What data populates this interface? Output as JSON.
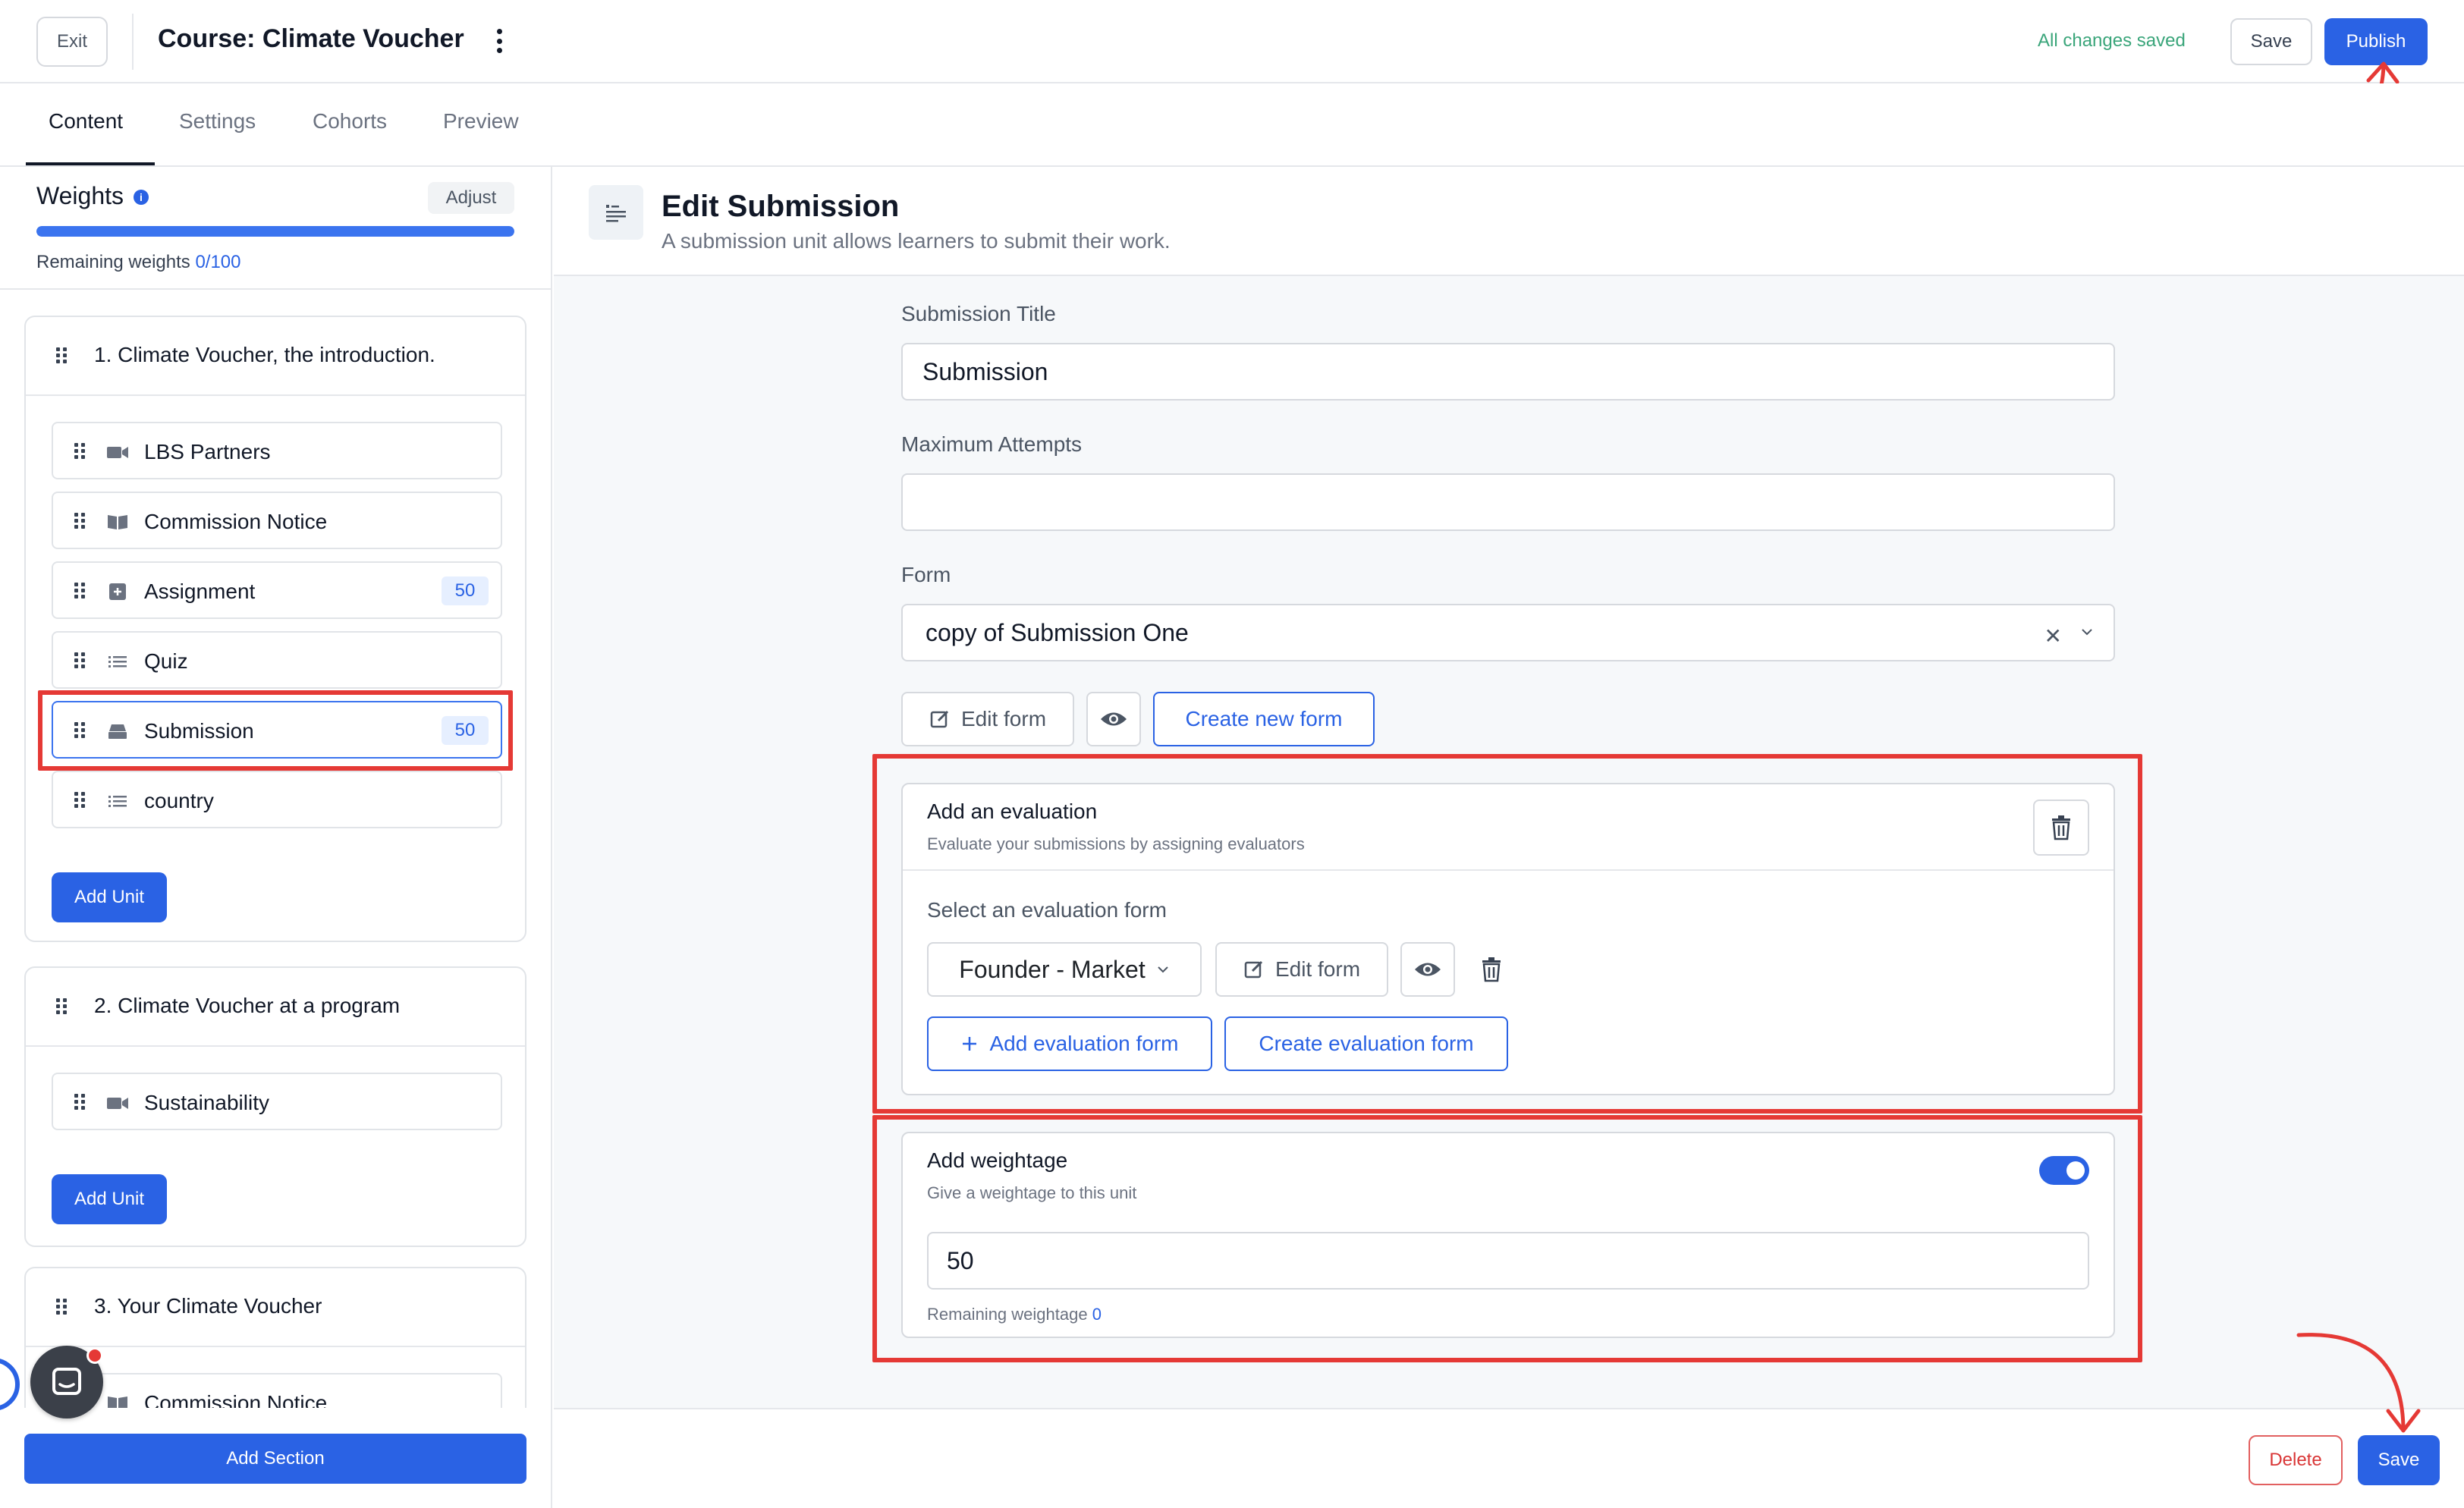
{
  "topbar": {
    "exit_label": "Exit",
    "course_title": "Course: Climate Voucher",
    "status_text": "All changes saved",
    "save_label": "Save",
    "publish_label": "Publish"
  },
  "tabs": [
    {
      "label": "Content",
      "active": true
    },
    {
      "label": "Settings",
      "active": false
    },
    {
      "label": "Cohorts",
      "active": false
    },
    {
      "label": "Preview",
      "active": false
    }
  ],
  "sidebar": {
    "weights_title": "Weights",
    "adjust_label": "Adjust",
    "remaining_prefix": "Remaining weights ",
    "remaining_value": "0/100",
    "progress_fraction": 1.0,
    "sections": [
      {
        "title": "1. Climate Voucher, the introduction.",
        "units": [
          {
            "label": "LBS Partners",
            "icon": "video-icon",
            "badge": ""
          },
          {
            "label": "Commission Notice",
            "icon": "book-icon",
            "badge": ""
          },
          {
            "label": "Assignment",
            "icon": "assignment-icon",
            "badge": "50"
          },
          {
            "label": "Quiz",
            "icon": "list-icon",
            "badge": ""
          },
          {
            "label": "Submission",
            "icon": "inbox-icon",
            "badge": "50",
            "selected": true
          },
          {
            "label": "country",
            "icon": "list-icon",
            "badge": ""
          }
        ],
        "add_unit_label": "Add Unit"
      },
      {
        "title": "2. Climate Voucher at a program",
        "units": [
          {
            "label": "Sustainability",
            "icon": "video-icon",
            "badge": ""
          }
        ],
        "add_unit_label": "Add Unit"
      },
      {
        "title": "3. Your Climate Voucher",
        "units": [
          {
            "label": "Commission Notice",
            "icon": "book-icon",
            "badge": ""
          }
        ]
      }
    ],
    "add_section_label": "Add Section"
  },
  "main": {
    "header_title": "Edit Submission",
    "header_subtitle": "A submission unit allows learners to submit their work.",
    "submission_title_label": "Submission Title",
    "submission_title_value": "Submission",
    "max_attempts_label": "Maximum Attempts",
    "max_attempts_value": "",
    "form_label": "Form",
    "form_value": "copy of Submission One",
    "edit_form_label": "Edit form",
    "create_new_form_label": "Create new form",
    "evaluation": {
      "title": "Add an evaluation",
      "subtitle": "Evaluate your submissions by assigning evaluators",
      "select_label": "Select an evaluation form",
      "selected_form": "Founder - Market",
      "edit_form_label": "Edit form",
      "add_eval_form_label": "Add evaluation form",
      "create_eval_form_label": "Create evaluation form"
    },
    "weightage": {
      "title": "Add weightage",
      "subtitle": "Give a weightage to this unit",
      "enabled": true,
      "value": "50",
      "remaining_prefix": "Remaining weightage ",
      "remaining_value": "0"
    },
    "delete_label": "Delete",
    "save_label": "Save"
  },
  "colors": {
    "accent": "#2a62e4",
    "highlight": "#e53935",
    "saved_green": "#3aa57a"
  }
}
